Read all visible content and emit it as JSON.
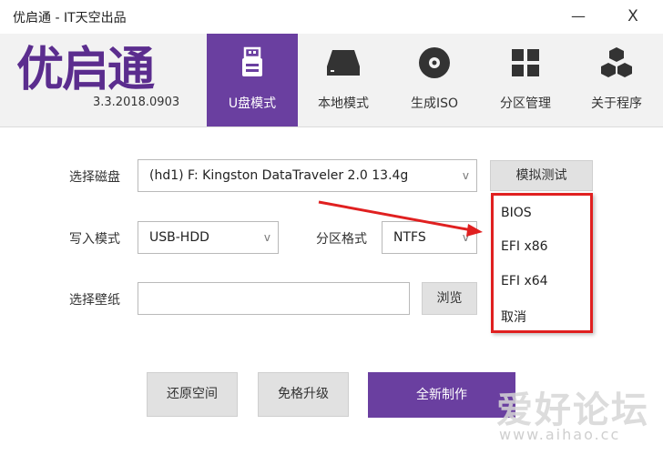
{
  "window": {
    "title": "优启通 - IT天空出品",
    "minimize": "—",
    "close": "X"
  },
  "app": {
    "logo": "优启通",
    "version": "3.3.2018.0903"
  },
  "tabs": [
    {
      "label": "U盘模式",
      "icon": "usb-drive-icon"
    },
    {
      "label": "本地模式",
      "icon": "hard-disk-icon"
    },
    {
      "label": "生成ISO",
      "icon": "disc-icon"
    },
    {
      "label": "分区管理",
      "icon": "partition-grid-icon"
    },
    {
      "label": "关于程序",
      "icon": "cubes-icon"
    }
  ],
  "form": {
    "disk_label": "选择磁盘",
    "disk_value": "(hd1) F: Kingston DataTraveler 2.0 13.4g",
    "write_mode_label": "写入模式",
    "write_mode_value": "USB-HDD",
    "partition_format_label": "分区格式",
    "partition_format_value": "NTFS",
    "wallpaper_label": "选择壁纸",
    "wallpaper_value": "",
    "browse_label": "浏览",
    "simulate_label": "模拟测试",
    "caret": "v"
  },
  "simulate_menu": {
    "items": [
      "BIOS",
      "EFI x86",
      "EFI x64",
      "取消"
    ]
  },
  "actions": {
    "restore": "还原空间",
    "upgrade": "免格升级",
    "create": "全新制作"
  },
  "watermark": {
    "text": "爱好论坛",
    "url": "www.aihao.cc"
  },
  "colors": {
    "accent": "#6a3fa0",
    "highlight": "#e02020"
  }
}
